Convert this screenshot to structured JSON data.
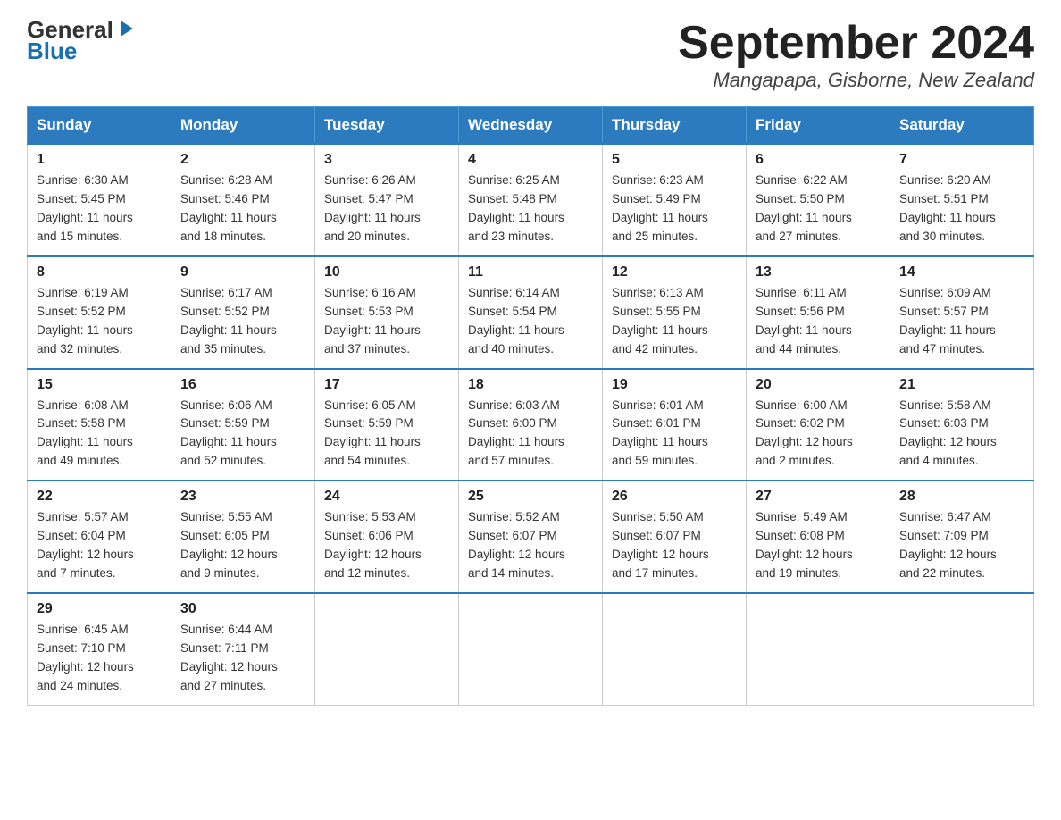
{
  "header": {
    "logo_line1": "General",
    "logo_line2": "Blue",
    "month": "September 2024",
    "location": "Mangapapa, Gisborne, New Zealand"
  },
  "days_of_week": [
    "Sunday",
    "Monday",
    "Tuesday",
    "Wednesday",
    "Thursday",
    "Friday",
    "Saturday"
  ],
  "weeks": [
    [
      {
        "day": "1",
        "info": "Sunrise: 6:30 AM\nSunset: 5:45 PM\nDaylight: 11 hours\nand 15 minutes."
      },
      {
        "day": "2",
        "info": "Sunrise: 6:28 AM\nSunset: 5:46 PM\nDaylight: 11 hours\nand 18 minutes."
      },
      {
        "day": "3",
        "info": "Sunrise: 6:26 AM\nSunset: 5:47 PM\nDaylight: 11 hours\nand 20 minutes."
      },
      {
        "day": "4",
        "info": "Sunrise: 6:25 AM\nSunset: 5:48 PM\nDaylight: 11 hours\nand 23 minutes."
      },
      {
        "day": "5",
        "info": "Sunrise: 6:23 AM\nSunset: 5:49 PM\nDaylight: 11 hours\nand 25 minutes."
      },
      {
        "day": "6",
        "info": "Sunrise: 6:22 AM\nSunset: 5:50 PM\nDaylight: 11 hours\nand 27 minutes."
      },
      {
        "day": "7",
        "info": "Sunrise: 6:20 AM\nSunset: 5:51 PM\nDaylight: 11 hours\nand 30 minutes."
      }
    ],
    [
      {
        "day": "8",
        "info": "Sunrise: 6:19 AM\nSunset: 5:52 PM\nDaylight: 11 hours\nand 32 minutes."
      },
      {
        "day": "9",
        "info": "Sunrise: 6:17 AM\nSunset: 5:52 PM\nDaylight: 11 hours\nand 35 minutes."
      },
      {
        "day": "10",
        "info": "Sunrise: 6:16 AM\nSunset: 5:53 PM\nDaylight: 11 hours\nand 37 minutes."
      },
      {
        "day": "11",
        "info": "Sunrise: 6:14 AM\nSunset: 5:54 PM\nDaylight: 11 hours\nand 40 minutes."
      },
      {
        "day": "12",
        "info": "Sunrise: 6:13 AM\nSunset: 5:55 PM\nDaylight: 11 hours\nand 42 minutes."
      },
      {
        "day": "13",
        "info": "Sunrise: 6:11 AM\nSunset: 5:56 PM\nDaylight: 11 hours\nand 44 minutes."
      },
      {
        "day": "14",
        "info": "Sunrise: 6:09 AM\nSunset: 5:57 PM\nDaylight: 11 hours\nand 47 minutes."
      }
    ],
    [
      {
        "day": "15",
        "info": "Sunrise: 6:08 AM\nSunset: 5:58 PM\nDaylight: 11 hours\nand 49 minutes."
      },
      {
        "day": "16",
        "info": "Sunrise: 6:06 AM\nSunset: 5:59 PM\nDaylight: 11 hours\nand 52 minutes."
      },
      {
        "day": "17",
        "info": "Sunrise: 6:05 AM\nSunset: 5:59 PM\nDaylight: 11 hours\nand 54 minutes."
      },
      {
        "day": "18",
        "info": "Sunrise: 6:03 AM\nSunset: 6:00 PM\nDaylight: 11 hours\nand 57 minutes."
      },
      {
        "day": "19",
        "info": "Sunrise: 6:01 AM\nSunset: 6:01 PM\nDaylight: 11 hours\nand 59 minutes."
      },
      {
        "day": "20",
        "info": "Sunrise: 6:00 AM\nSunset: 6:02 PM\nDaylight: 12 hours\nand 2 minutes."
      },
      {
        "day": "21",
        "info": "Sunrise: 5:58 AM\nSunset: 6:03 PM\nDaylight: 12 hours\nand 4 minutes."
      }
    ],
    [
      {
        "day": "22",
        "info": "Sunrise: 5:57 AM\nSunset: 6:04 PM\nDaylight: 12 hours\nand 7 minutes."
      },
      {
        "day": "23",
        "info": "Sunrise: 5:55 AM\nSunset: 6:05 PM\nDaylight: 12 hours\nand 9 minutes."
      },
      {
        "day": "24",
        "info": "Sunrise: 5:53 AM\nSunset: 6:06 PM\nDaylight: 12 hours\nand 12 minutes."
      },
      {
        "day": "25",
        "info": "Sunrise: 5:52 AM\nSunset: 6:07 PM\nDaylight: 12 hours\nand 14 minutes."
      },
      {
        "day": "26",
        "info": "Sunrise: 5:50 AM\nSunset: 6:07 PM\nDaylight: 12 hours\nand 17 minutes."
      },
      {
        "day": "27",
        "info": "Sunrise: 5:49 AM\nSunset: 6:08 PM\nDaylight: 12 hours\nand 19 minutes."
      },
      {
        "day": "28",
        "info": "Sunrise: 6:47 AM\nSunset: 7:09 PM\nDaylight: 12 hours\nand 22 minutes."
      }
    ],
    [
      {
        "day": "29",
        "info": "Sunrise: 6:45 AM\nSunset: 7:10 PM\nDaylight: 12 hours\nand 24 minutes."
      },
      {
        "day": "30",
        "info": "Sunrise: 6:44 AM\nSunset: 7:11 PM\nDaylight: 12 hours\nand 27 minutes."
      },
      {
        "day": "",
        "info": ""
      },
      {
        "day": "",
        "info": ""
      },
      {
        "day": "",
        "info": ""
      },
      {
        "day": "",
        "info": ""
      },
      {
        "day": "",
        "info": ""
      }
    ]
  ]
}
